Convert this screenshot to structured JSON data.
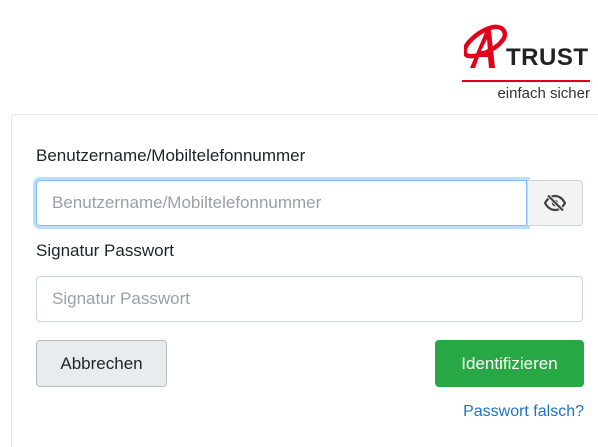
{
  "brand": {
    "name": "TRUST",
    "tagline": "einfach sicher",
    "accent_color": "#e2001a"
  },
  "form": {
    "username_label": "Benutzername/Mobiltelefonnummer",
    "username_placeholder": "Benutzername/Mobiltelefonnummer",
    "username_value": "",
    "visibility_toggle_icon": "eye-slash-icon",
    "password_label": "Signatur Passwort",
    "password_placeholder": "Signatur Passwort",
    "password_value": ""
  },
  "actions": {
    "cancel_label": "Abbrechen",
    "submit_label": "Identifizieren",
    "submit_color": "#28a745",
    "forgot_link": "Passwort falsch?"
  }
}
